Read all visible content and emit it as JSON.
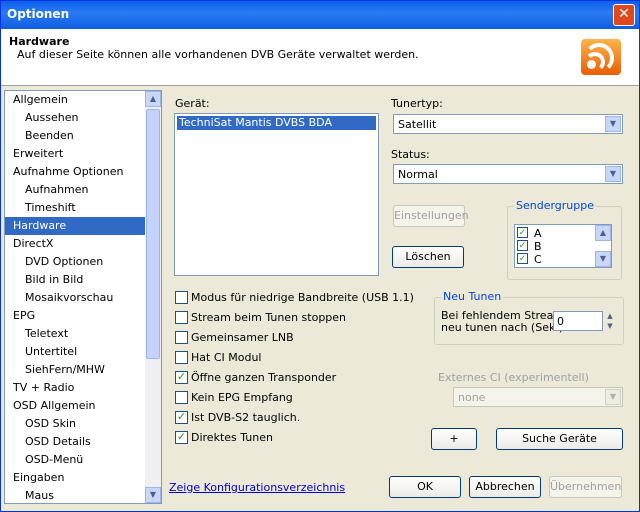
{
  "window": {
    "title": "Optionen",
    "close_glyph": "✕"
  },
  "header": {
    "title": "Hardware",
    "subtitle": "Auf dieser Seite können alle vorhandenen DVB Geräte verwaltet werden.",
    "icon": "rss-icon"
  },
  "nav": {
    "items": [
      {
        "label": "Allgemein",
        "indent": 0
      },
      {
        "label": "Aussehen",
        "indent": 1
      },
      {
        "label": "Beenden",
        "indent": 1
      },
      {
        "label": "Erweitert",
        "indent": 0
      },
      {
        "label": "Aufnahme Optionen",
        "indent": 0
      },
      {
        "label": "Aufnahmen",
        "indent": 1
      },
      {
        "label": "Timeshift",
        "indent": 1
      },
      {
        "label": "Hardware",
        "indent": 0,
        "selected": true
      },
      {
        "label": "DirectX",
        "indent": 0
      },
      {
        "label": "DVD Optionen",
        "indent": 1
      },
      {
        "label": "Bild in Bild",
        "indent": 1
      },
      {
        "label": "Mosaikvorschau",
        "indent": 1
      },
      {
        "label": "EPG",
        "indent": 0
      },
      {
        "label": "Teletext",
        "indent": 1
      },
      {
        "label": "Untertitel",
        "indent": 1
      },
      {
        "label": "SiehFern/MHW",
        "indent": 1
      },
      {
        "label": "TV + Radio",
        "indent": 0
      },
      {
        "label": "OSD Allgemein",
        "indent": 0
      },
      {
        "label": "OSD Skin",
        "indent": 1
      },
      {
        "label": "OSD Details",
        "indent": 1
      },
      {
        "label": "OSD-Menü",
        "indent": 1
      },
      {
        "label": "Eingaben",
        "indent": 0
      },
      {
        "label": "Maus",
        "indent": 1
      }
    ]
  },
  "device": {
    "label": "Gerät:",
    "items": [
      "TechniSat Mantis DVBS BDA Receiver"
    ]
  },
  "tuner": {
    "label": "Tunertyp:",
    "value": "Satellit"
  },
  "status": {
    "label": "Status:",
    "value": "Normal"
  },
  "buttons": {
    "settings": "Einstellungen",
    "delete": "Löschen",
    "add": "+",
    "search": "Suche Geräte",
    "ok": "OK",
    "cancel": "Abbrechen",
    "apply": "Übernehmen"
  },
  "sender_group": {
    "title": "Sendergruppe",
    "items": [
      {
        "label": "A",
        "checked": true
      },
      {
        "label": "B",
        "checked": true
      },
      {
        "label": "C",
        "checked": true
      }
    ]
  },
  "options": [
    {
      "label": "Modus für niedrige Bandbreite (USB 1.1)",
      "checked": false
    },
    {
      "label": "Stream beim Tunen stoppen",
      "checked": false
    },
    {
      "label": "Gemeinsamer LNB",
      "checked": false
    },
    {
      "label": "Hat CI Modul",
      "checked": false
    },
    {
      "label": "Öffne ganzen Transponder",
      "checked": true
    },
    {
      "label": "Kein EPG Empfang",
      "checked": false
    },
    {
      "label": "Ist DVB-S2 tauglich.",
      "checked": true
    },
    {
      "label": "Direktes Tunen",
      "checked": true
    }
  ],
  "retune": {
    "title": "Neu Tunen",
    "line1": "Bei fehlendem Stream",
    "line2": "neu tunen nach (Sek.)",
    "value": "0"
  },
  "external_ci": {
    "label": "Externes CI (experimentell)",
    "value": "none"
  },
  "link": "Zeige Konfigurationsverzeichnis",
  "colors": {
    "accent": "#316AC5",
    "group_title": "#0046D5",
    "title_bar": "#0A5FEB"
  }
}
